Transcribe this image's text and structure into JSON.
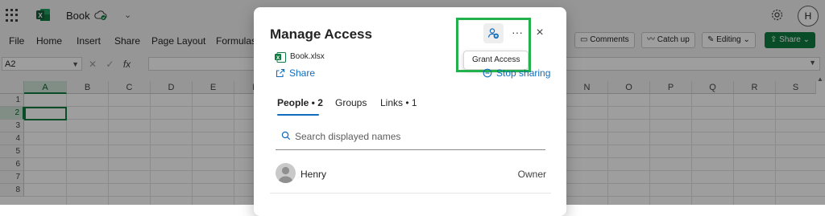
{
  "titlebar": {
    "workbook_name": "Book",
    "app_icon": "excel-icon",
    "sync_icon": "cloud-synced-icon",
    "settings_icon": "gear-icon",
    "account_initial": "H"
  },
  "ribbon": {
    "tabs": [
      "File",
      "Home",
      "Insert",
      "Share",
      "Page Layout",
      "Formulas"
    ],
    "comments_label": "Comments",
    "catchup_label": "Catch up",
    "editing_label": "Editing",
    "share_label": "Share"
  },
  "formula_bar": {
    "name_box": "A2",
    "fx_label": "fx",
    "formula_value": ""
  },
  "grid": {
    "columns": [
      "A",
      "B",
      "C",
      "D",
      "E",
      "F",
      "N",
      "O",
      "P",
      "Q",
      "R",
      "S"
    ],
    "rows": [
      "1",
      "2",
      "3",
      "4",
      "5",
      "6",
      "7",
      "8"
    ],
    "active_cell": "A2"
  },
  "dialog": {
    "title": "Manage Access",
    "grant_icon": "add-people-icon",
    "more_label": "···",
    "close_label": "×",
    "tooltip": "Grant Access",
    "file_name": "Book.xlsx",
    "share_label": "Share",
    "stop_label": "Stop sharing",
    "tabs": [
      {
        "label": "People • 2",
        "active": true
      },
      {
        "label": "Groups",
        "active": false
      },
      {
        "label": "Links • 1",
        "active": false
      }
    ],
    "search_placeholder": "Search displayed names",
    "people": [
      {
        "name": "Henry",
        "role": "Owner"
      }
    ]
  },
  "colors": {
    "excel_green": "#107c41",
    "link_blue": "#0f6cbd",
    "highlight_green": "#22b14c"
  }
}
